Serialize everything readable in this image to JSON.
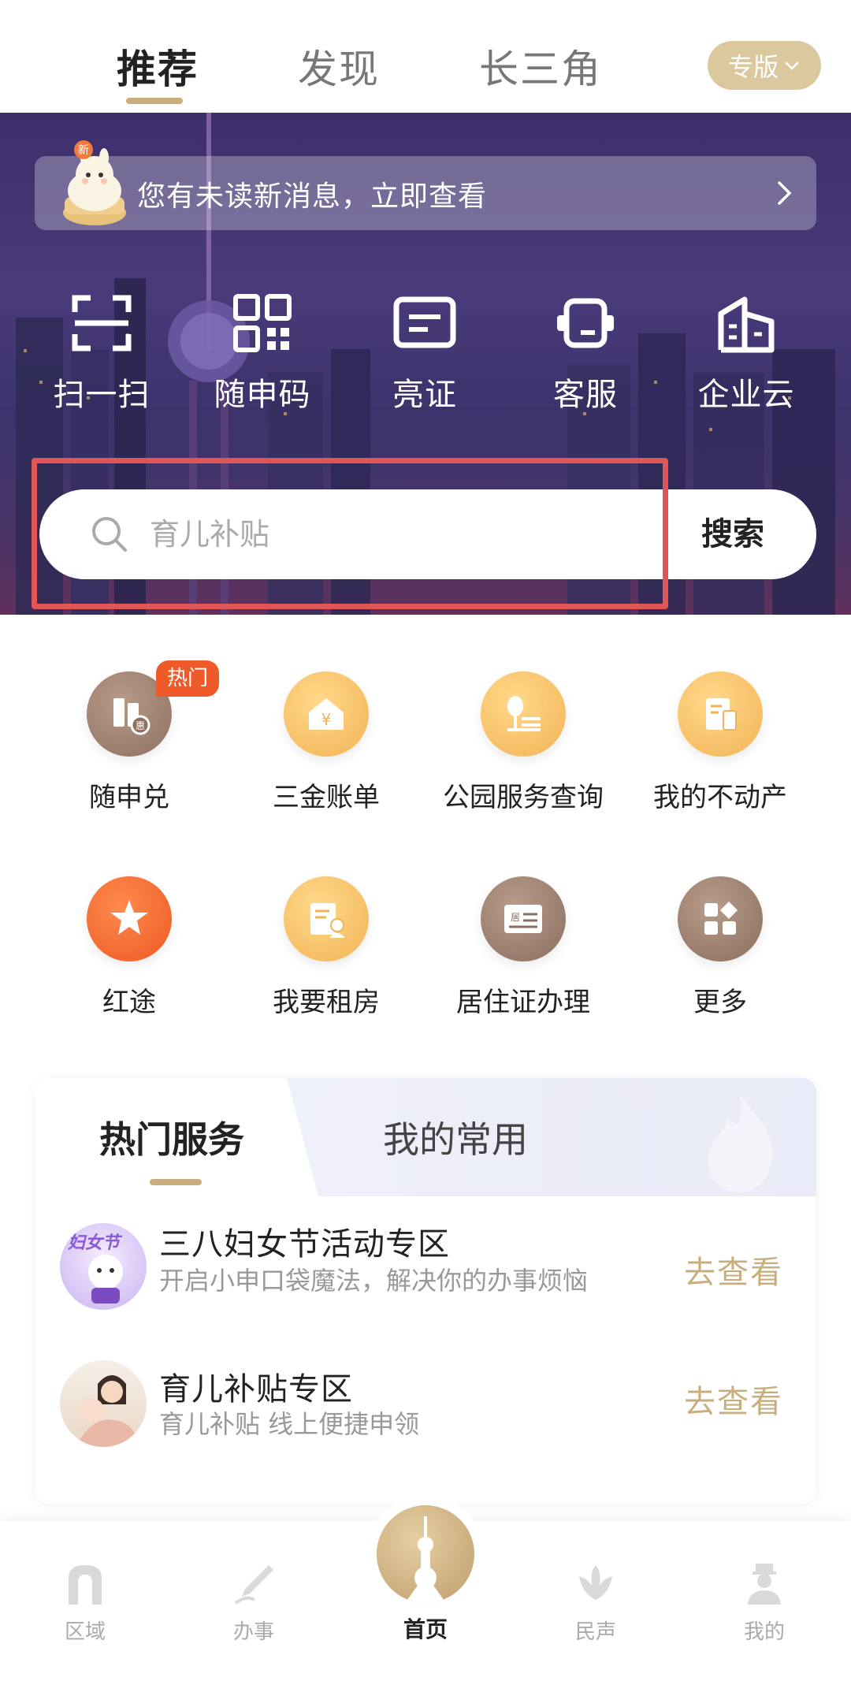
{
  "top_tabs": [
    {
      "label": "推荐",
      "active": true
    },
    {
      "label": "发现",
      "active": false
    },
    {
      "label": "长三角",
      "active": false
    }
  ],
  "edition_button": "专版",
  "notice": {
    "badge": "新",
    "text": "您有未读新消息，立即查看"
  },
  "quick_actions": [
    {
      "label": "扫一扫",
      "icon": "scan-icon"
    },
    {
      "label": "随申码",
      "icon": "qr-code-icon"
    },
    {
      "label": "亮证",
      "icon": "id-card-icon"
    },
    {
      "label": "客服",
      "icon": "customer-service-icon"
    },
    {
      "label": "企业云",
      "icon": "enterprise-cloud-icon"
    }
  ],
  "search": {
    "placeholder": "育儿补贴",
    "button": "搜索"
  },
  "services": [
    {
      "label": "随申兑",
      "icon": "voucher-icon",
      "badge": "热门",
      "color": "#8e7060"
    },
    {
      "label": "三金账单",
      "icon": "yuan-house-icon",
      "color": "#f2b356"
    },
    {
      "label": "公园服务查询",
      "icon": "park-icon",
      "color": "#f2b356"
    },
    {
      "label": "我的不动产",
      "icon": "property-icon",
      "color": "#f2b356"
    },
    {
      "label": "红途",
      "icon": "red-star-icon",
      "color": "#ec5a22"
    },
    {
      "label": "我要租房",
      "icon": "rent-icon",
      "color": "#f2b356"
    },
    {
      "label": "居住证办理",
      "icon": "residence-permit-icon",
      "color": "#8a6e5f"
    },
    {
      "label": "更多",
      "icon": "more-grid-icon",
      "color": "#8a6e5f"
    }
  ],
  "service_card": {
    "tabs": [
      {
        "label": "热门服务",
        "active": true
      },
      {
        "label": "我的常用",
        "active": false
      }
    ],
    "items": [
      {
        "avatar_text": "妇女节",
        "title": "三八妇女节活动专区",
        "desc": "开启小申口袋魔法，解决你的办事烦恼",
        "link": "去查看"
      },
      {
        "title": "育儿补贴专区",
        "desc": "育儿补贴 线上便捷申领",
        "link": "去查看"
      }
    ]
  },
  "bottom_nav": [
    {
      "label": "区域",
      "icon": "region-icon"
    },
    {
      "label": "办事",
      "icon": "handle-affairs-icon"
    },
    {
      "label": "首页",
      "icon": "home-tower-icon",
      "active": true
    },
    {
      "label": "民声",
      "icon": "public-voice-icon"
    },
    {
      "label": "我的",
      "icon": "profile-icon"
    }
  ],
  "colors": {
    "accent_gold": "#c9ae7d",
    "hero_purple": "#3d2f6a",
    "highlight_red": "#e05656"
  }
}
